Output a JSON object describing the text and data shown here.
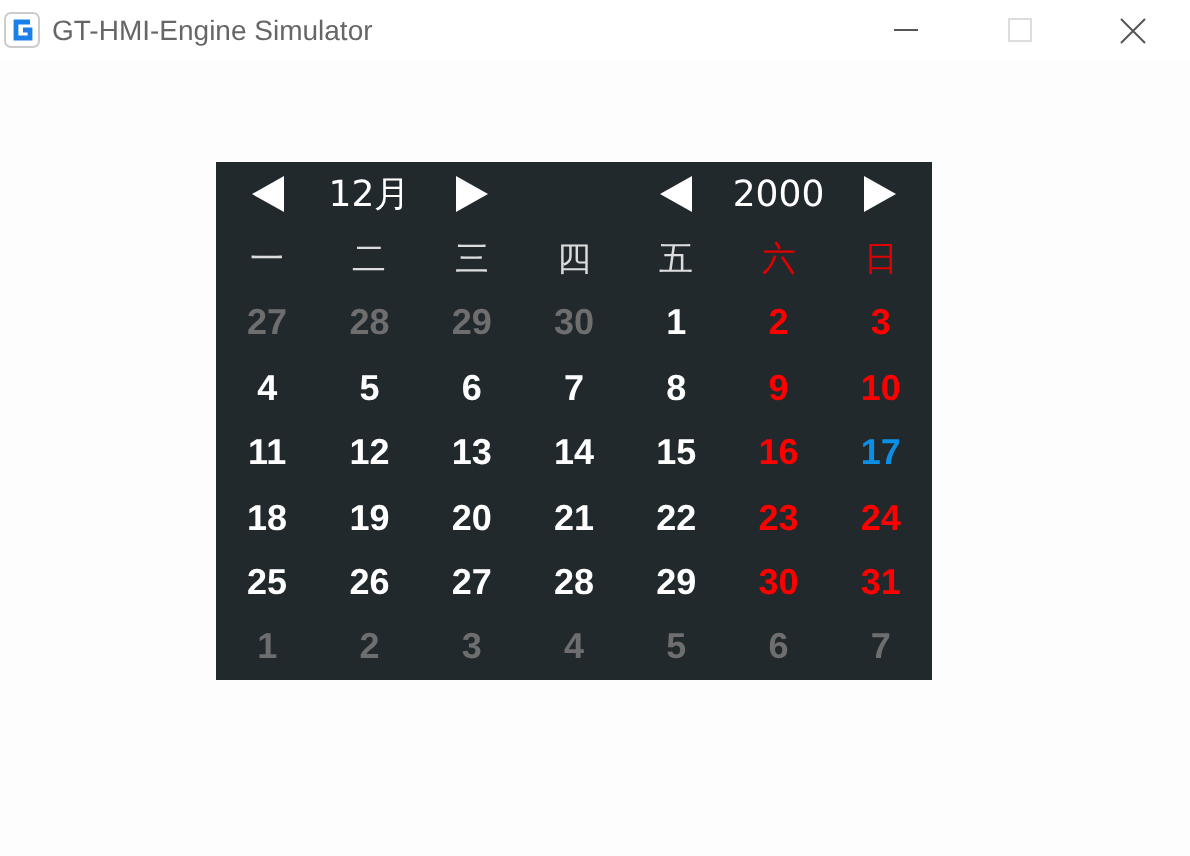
{
  "window": {
    "title": "GT-HMI-Engine Simulator"
  },
  "calendar": {
    "month": "12月",
    "year": "2000",
    "weekdays": [
      {
        "label": "一",
        "kind": "weekday"
      },
      {
        "label": "二",
        "kind": "weekday"
      },
      {
        "label": "三",
        "kind": "weekday"
      },
      {
        "label": "四",
        "kind": "weekday"
      },
      {
        "label": "五",
        "kind": "weekday"
      },
      {
        "label": "六",
        "kind": "weekend"
      },
      {
        "label": "日",
        "kind": "weekend"
      }
    ],
    "days": [
      {
        "label": "27",
        "kind": "other"
      },
      {
        "label": "28",
        "kind": "other"
      },
      {
        "label": "29",
        "kind": "other"
      },
      {
        "label": "30",
        "kind": "other"
      },
      {
        "label": "1",
        "kind": "weekday"
      },
      {
        "label": "2",
        "kind": "weekend"
      },
      {
        "label": "3",
        "kind": "weekend"
      },
      {
        "label": "4",
        "kind": "weekday"
      },
      {
        "label": "5",
        "kind": "weekday"
      },
      {
        "label": "6",
        "kind": "weekday"
      },
      {
        "label": "7",
        "kind": "weekday"
      },
      {
        "label": "8",
        "kind": "weekday"
      },
      {
        "label": "9",
        "kind": "weekend"
      },
      {
        "label": "10",
        "kind": "weekend"
      },
      {
        "label": "11",
        "kind": "weekday"
      },
      {
        "label": "12",
        "kind": "weekday"
      },
      {
        "label": "13",
        "kind": "weekday"
      },
      {
        "label": "14",
        "kind": "weekday"
      },
      {
        "label": "15",
        "kind": "weekday"
      },
      {
        "label": "16",
        "kind": "weekend"
      },
      {
        "label": "17",
        "kind": "today"
      },
      {
        "label": "18",
        "kind": "weekday"
      },
      {
        "label": "19",
        "kind": "weekday"
      },
      {
        "label": "20",
        "kind": "weekday"
      },
      {
        "label": "21",
        "kind": "weekday"
      },
      {
        "label": "22",
        "kind": "weekday"
      },
      {
        "label": "23",
        "kind": "weekend"
      },
      {
        "label": "24",
        "kind": "weekend"
      },
      {
        "label": "25",
        "kind": "weekday"
      },
      {
        "label": "26",
        "kind": "weekday"
      },
      {
        "label": "27",
        "kind": "weekday"
      },
      {
        "label": "28",
        "kind": "weekday"
      },
      {
        "label": "29",
        "kind": "weekday"
      },
      {
        "label": "30",
        "kind": "weekend"
      },
      {
        "label": "31",
        "kind": "weekend"
      },
      {
        "label": "1",
        "kind": "other"
      },
      {
        "label": "2",
        "kind": "other"
      },
      {
        "label": "3",
        "kind": "other"
      },
      {
        "label": "4",
        "kind": "other"
      },
      {
        "label": "5",
        "kind": "other"
      },
      {
        "label": "6",
        "kind": "other"
      },
      {
        "label": "7",
        "kind": "other"
      }
    ]
  }
}
